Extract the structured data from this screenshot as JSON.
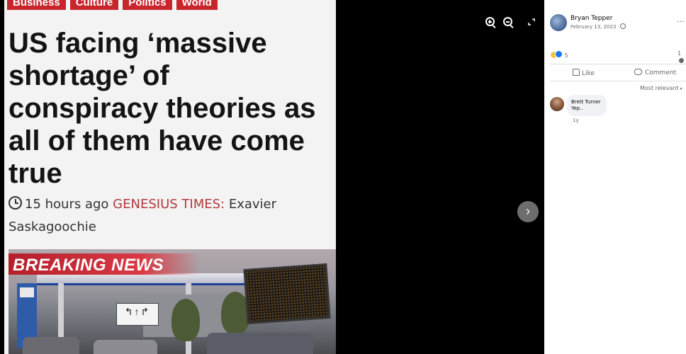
{
  "article": {
    "categories": [
      "Business",
      "Culture",
      "Politics",
      "World"
    ],
    "headline": "US facing ‘massive\nshortage’ of\nconspiracy theories as\nall of them have come\ntrue",
    "time_ago": "15 hours ago",
    "publication": "GENESIUS TIMES:",
    "author": "Exavier\nSaskagoochie",
    "image_banner": "BREAKING NEWS",
    "image_lane_sign": "↰↑↱"
  },
  "viewer_controls": {
    "fullscreen_icon": "expand-icon",
    "next_icon": "›"
  },
  "post": {
    "author": "Bryan Tepper",
    "date": "February 13, 2023 ·",
    "more_label": "···",
    "reaction_count": "5",
    "comment_count": "1",
    "like_label": "Like",
    "comment_label": "Comment",
    "sort_label": "Most relevant",
    "sort_caret": "▾"
  },
  "comments": [
    {
      "author": "Brett Turner",
      "text": "Yep..",
      "time": "1y"
    }
  ],
  "colors": {
    "category_red": "#c8262c",
    "viewer_bg": "#000000",
    "like_blue": "#1877f2",
    "secondary_text": "#65676b"
  }
}
